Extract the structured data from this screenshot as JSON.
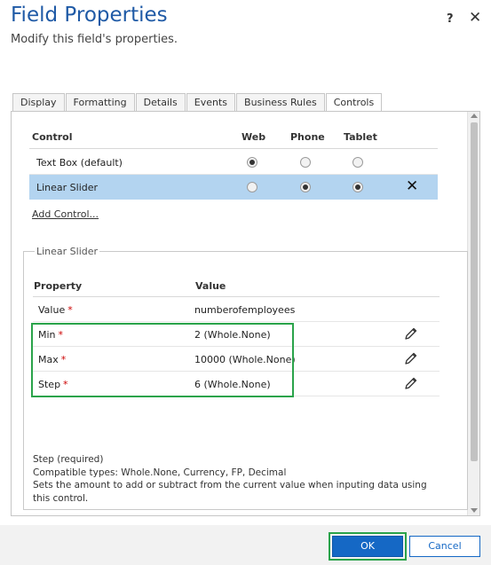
{
  "dialog": {
    "title": "Field Properties",
    "subtitle": "Modify this field's properties.",
    "help_label": "?",
    "close_label": "✕"
  },
  "tabs": [
    {
      "label": "Display"
    },
    {
      "label": "Formatting"
    },
    {
      "label": "Details"
    },
    {
      "label": "Events"
    },
    {
      "label": "Business Rules"
    },
    {
      "label": "Controls",
      "active": true
    }
  ],
  "controls_table": {
    "headers": {
      "control": "Control",
      "web": "Web",
      "phone": "Phone",
      "tablet": "Tablet"
    },
    "rows": [
      {
        "name": "Text Box (default)",
        "web": true,
        "phone": false,
        "tablet": false,
        "selected": false
      },
      {
        "name": "Linear Slider",
        "web": false,
        "phone": true,
        "tablet": true,
        "selected": true,
        "delete_label": "✕"
      }
    ],
    "add_control_label": "Add Control..."
  },
  "properties_group": {
    "legend": "Linear Slider",
    "headers": {
      "property": "Property",
      "value": "Value"
    },
    "required_marker": "*",
    "rows": [
      {
        "name": "Value",
        "value": "numberofemployees",
        "editable": false
      },
      {
        "name": "Min",
        "value": "2 (Whole.None)",
        "editable": true
      },
      {
        "name": "Max",
        "value": "10000 (Whole.None)",
        "editable": true
      },
      {
        "name": "Step",
        "value": "6 (Whole.None)",
        "editable": true
      }
    ],
    "help": {
      "line1": "Step (required)",
      "line2": "Compatible types: Whole.None, Currency, FP, Decimal",
      "line3": "Sets the amount to add or subtract from the current value when inputing data using this control."
    }
  },
  "footer": {
    "ok_label": "OK",
    "cancel_label": "Cancel"
  },
  "colors": {
    "title": "#1f5aa6",
    "selection": "#b3d4f0",
    "highlight": "#2aa34a",
    "primary": "#1568c5",
    "required": "#cc0000"
  },
  "icons": {
    "edit": "pencil-icon",
    "delete": "close-icon",
    "help": "help-icon"
  }
}
